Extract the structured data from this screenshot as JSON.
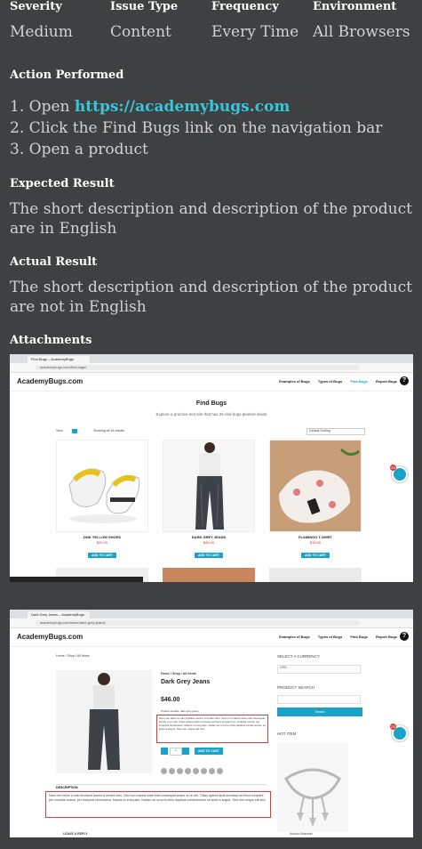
{
  "header": {
    "severity": {
      "label": "Severity",
      "value": "Medium"
    },
    "issue_type": {
      "label": "Issue Type",
      "value": "Content"
    },
    "frequency": {
      "label": "Frequency",
      "value": "Every Time"
    },
    "environment": {
      "label": "Environment",
      "value": "All Browsers"
    }
  },
  "action": {
    "heading": "Action Performed",
    "steps": [
      {
        "num": "1.",
        "prefix": "Open ",
        "link": "https://academybugs.com"
      },
      {
        "num": "2.",
        "text": "Click the Find Bugs link on the navigation bar"
      },
      {
        "num": "3.",
        "text": "Open a product"
      }
    ]
  },
  "expected": {
    "heading": "Expected Result",
    "text": "The short description and description of the product are in English"
  },
  "actual": {
    "heading": "Actual Result",
    "text": "The short description and description of the product are not in English"
  },
  "attachments": {
    "heading": "Attachments",
    "shot1": {
      "tab": "Find Bugs – AcademyBugs",
      "url": "academybugs.com/find-bugs/",
      "logo": "AcademyBugs.com",
      "nav": [
        "Examples of Bugs",
        "Types of Bugs",
        "Find Bugs",
        "Report Bugs"
      ],
      "title": "Find Bugs",
      "subtitle": "Explore a practice test site that has 25 real bugs planted inside",
      "view_label": "View",
      "showing": "Showing all 18 results",
      "sort": "Default Sorting",
      "products": [
        {
          "name": "DNK YELLOW SHOES",
          "price": "$20.00",
          "cart": "ADD TO CART"
        },
        {
          "name": "DARK GREY JEANS",
          "price": "$46.00",
          "cart": "ADD TO CART"
        },
        {
          "name": "FLAMINGO T-SHIRT",
          "price": "$15.50",
          "cart": "ADD TO CART"
        }
      ],
      "badge_count": "25"
    },
    "shot2": {
      "tab": "Dark Grey Jeans – AcademyBugs",
      "url": "academybugs.com/store/dark-grey-jeans/",
      "logo": "AcademyBugs.com",
      "nav": [
        "Examples of Bugs",
        "Types of Bugs",
        "Find Bugs",
        "Report Bugs"
      ],
      "breadcrumb": "Home / Shop / All Items",
      "product_crumb": "Home / Shop / All Items",
      "product_name": "Dark Grey Jeans",
      "price": "$46.00",
      "short_desc_intro": "Product Details: dark grey jeans",
      "short_desc": "Nam nec tellus a odio tincidunt auctor a ornare odio. Sed non mauris vitae erat consequat auctor eu in elit. Class aptent taciti sociosqu ad litora torquent per conubia nostra, per inceptos himenaeos. Mauris in erat justo. Nullam ac urna eu felis dapibus condimentum sit amet a augue. Sed non neque elit sed.",
      "qty": "1",
      "add_to_cart": "ADD TO CART",
      "currency_heading": "SELECT A CURRENCY",
      "currency_value": "USD",
      "search_heading": "PRODUCT SEARCH",
      "search_button": "Search",
      "hot_heading": "HOT ITEM",
      "hot_item_name": "Anchor Bracelet",
      "description_tab": "DESCRIPTION",
      "description": "Nam nec tellus a odio tincidunt auctor a ornare odio. Sed non mauris vitae erat consequat auctor eu in elit. Class aptent taciti sociosqu ad litora torquent per conubia nostra, per inceptos himenaeos. Mauris in erat justo. Nullam ac urna eu felis dapibus condimentum sit amet a augue. Sed non neque elit sed.",
      "reply_heading": "LEAVE A REPLY",
      "badge_count": "25"
    }
  }
}
